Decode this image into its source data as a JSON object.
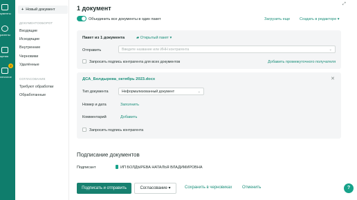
{
  "rail": {
    "items": [
      {
        "label": "кументы",
        "icon": "document-icon"
      },
      {
        "label": "рагенты",
        "icon": "contacts-icon"
      },
      {
        "label": "щения",
        "icon": "chat-icon"
      },
      {
        "label": "легочное",
        "icon": "inbox-icon",
        "badge": "2"
      }
    ],
    "accent": "#0f7d6c"
  },
  "sidebar": {
    "new_doc": "Новый документ",
    "section_docflow": "ДОКУМЕНТООБОРОТ",
    "items_docflow": [
      "Входящие",
      "Исходящие",
      "Внутренние",
      "Черновики",
      "Удалённые"
    ],
    "section_approval": "СОГЛАСОВАНИЕ",
    "items_approval": [
      "Требуют обработки",
      "Обработанные"
    ]
  },
  "main": {
    "title": "1 документ",
    "toggle_label": "Объединить все документы в один пакет",
    "upload_all": "Загрузить еще",
    "create_in_editor": "Создать в редакторе"
  },
  "package": {
    "title": "Пакет из 1 документа",
    "type": "Открытый пакет",
    "send_label": "Отправить",
    "contractor_placeholder": "Введите название или ИНН контрагента",
    "request_all_label": "Запросить подпись контрагента для всех документов",
    "add_intermediate": "Добавить промежуточного получателя"
  },
  "document": {
    "name": "ДСА_Болдырева_октябрь 2023.docx",
    "type_label": "Тип документа",
    "type_value": "Неформализованный документ",
    "number_label": "Номер и дата",
    "number_action": "Заполнить",
    "comment_label": "Комментарий",
    "comment_action": "Добавить",
    "request_label": "Запросить подпись контрагента"
  },
  "signing": {
    "title": "Подписание документов",
    "signer_label": "Подписант",
    "signer_name": "ИП БОЛДЫРЕВА НАТАЛЬЯ ВЛАДИМИРОВНА"
  },
  "actions": {
    "sign_send": "Подписать и отправить",
    "approval": "Согласование",
    "save_draft": "Сохранить в черновиках",
    "cancel": "Отменить",
    "help": "?"
  },
  "colors": {
    "accent": "#17a28a",
    "link": "#1a8f7a",
    "card_bg": "#f4f5f6"
  }
}
